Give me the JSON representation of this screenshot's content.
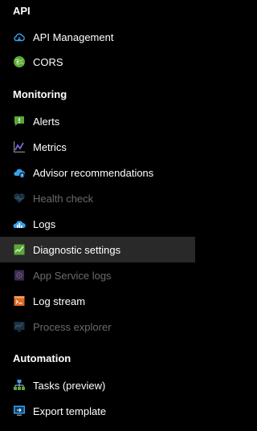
{
  "colors": {
    "background": "#000000",
    "selected_row": "#292929",
    "text": "#ffffff",
    "disabled_text": "#6b6b6b"
  },
  "sections": {
    "api": {
      "title": "API",
      "items": [
        {
          "label": "API Management",
          "icon": "cloud-icon"
        },
        {
          "label": "CORS",
          "icon": "cors-globe-icon"
        }
      ]
    },
    "monitoring": {
      "title": "Monitoring",
      "items": [
        {
          "label": "Alerts",
          "icon": "alert-icon"
        },
        {
          "label": "Metrics",
          "icon": "metrics-icon"
        },
        {
          "label": "Advisor recommendations",
          "icon": "advisor-icon"
        },
        {
          "label": "Health check",
          "icon": "heart-icon",
          "disabled": true
        },
        {
          "label": "Logs",
          "icon": "logs-icon"
        },
        {
          "label": "Diagnostic settings",
          "icon": "diagnostic-icon",
          "selected": true
        },
        {
          "label": "App Service logs",
          "icon": "app-service-logs-icon",
          "disabled": true
        },
        {
          "label": "Log stream",
          "icon": "log-stream-icon"
        },
        {
          "label": "Process explorer",
          "icon": "process-explorer-icon",
          "disabled": true
        }
      ]
    },
    "automation": {
      "title": "Automation",
      "items": [
        {
          "label": "Tasks (preview)",
          "icon": "tasks-icon"
        },
        {
          "label": "Export template",
          "icon": "export-template-icon"
        }
      ]
    }
  }
}
